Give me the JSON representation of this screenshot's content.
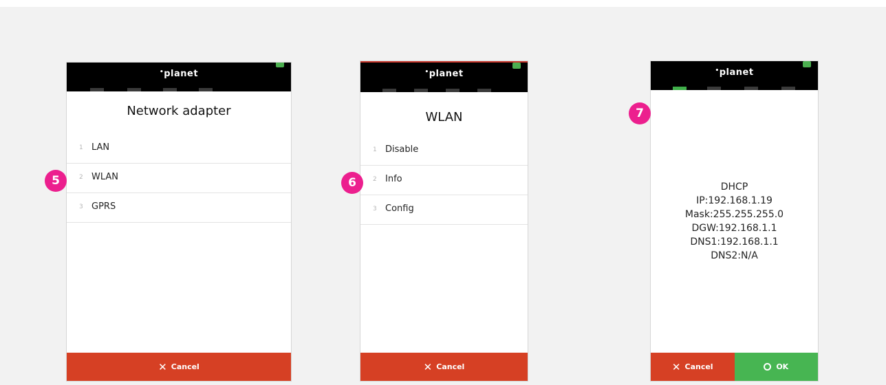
{
  "colors": {
    "background": "#f2f2f2",
    "topbar": "#000000",
    "cancel": "#d64024",
    "ok": "#47b552",
    "badge": "#ec1f8e",
    "active_tab": "#3fae49"
  },
  "brand": "planet",
  "screens": [
    {
      "title": "Network adapter",
      "step": "5",
      "items": [
        {
          "num": "1",
          "label": "LAN"
        },
        {
          "num": "2",
          "label": "WLAN"
        },
        {
          "num": "3",
          "label": "GPRS"
        }
      ],
      "cancel_label": "Cancel"
    },
    {
      "title": "WLAN",
      "step": "6",
      "items": [
        {
          "num": "1",
          "label": "Disable"
        },
        {
          "num": "2",
          "label": "Info"
        },
        {
          "num": "3",
          "label": "Config"
        }
      ],
      "cancel_label": "Cancel"
    },
    {
      "step": "7",
      "info_lines": [
        "DHCP",
        "IP:192.168.1.19",
        "Mask:255.255.255.0",
        "DGW:192.168.1.1",
        "DNS1:192.168.1.1",
        "DNS2:N/A"
      ],
      "cancel_label": "Cancel",
      "ok_label": "OK"
    }
  ]
}
